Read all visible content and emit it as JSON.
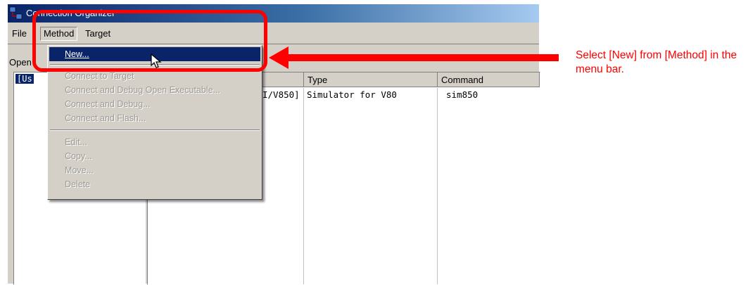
{
  "window": {
    "title": "Connection Organizer"
  },
  "menubar": {
    "items": [
      "File",
      "Method",
      "Target"
    ]
  },
  "panel": {
    "open_label": "Open"
  },
  "tree": {
    "selected_node": "[Us"
  },
  "list": {
    "columns": [
      "",
      "Type",
      "Command"
    ],
    "rows": [
      {
        "name": "I/V850]",
        "type": "Simulator for V80",
        "command": "sim850"
      }
    ]
  },
  "dropdown": {
    "highlighted": "New...",
    "items": [
      "Connect to Target",
      "Connect and Debug Open Executable...",
      "Connect and Debug...",
      "Connect and Flash...",
      "Edit...",
      "Copy...",
      "Move...",
      "Delete"
    ]
  },
  "annotation": {
    "text": "Select [New] from [Method] in the menu bar.",
    "color": "#ff0000"
  }
}
